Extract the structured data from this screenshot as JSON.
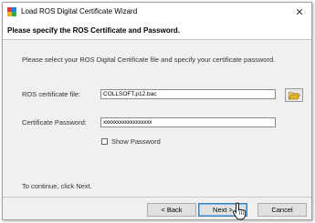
{
  "window": {
    "title": "Load ROS Digital Certificate Wizard",
    "close_glyph": "✕"
  },
  "header": {
    "title": "Please specify the ROS Certificate and Password."
  },
  "form": {
    "instruction": "Please select your ROS Digital Certificate file and specify your certificate password.",
    "cert_label": "ROS certificate file:",
    "cert_value": "COLLSOFT.p12.bac",
    "password_label": "Certificate Password:",
    "password_value": "xxxxxxxxxxxxxxxxxx",
    "show_password_label": "Show Password",
    "show_password_checked": false,
    "continue_text": "To continue, click Next."
  },
  "buttons": {
    "back": "< Back",
    "next": "Next >",
    "cancel": "Cancel"
  },
  "icons": {
    "app": "app-logo-icon",
    "browse": "folder-open-icon",
    "close": "close-icon",
    "cursor": "mouse-pointer-icon"
  },
  "colors": {
    "folder": "#e8b422",
    "default_button_border": "#3c7fb1"
  }
}
